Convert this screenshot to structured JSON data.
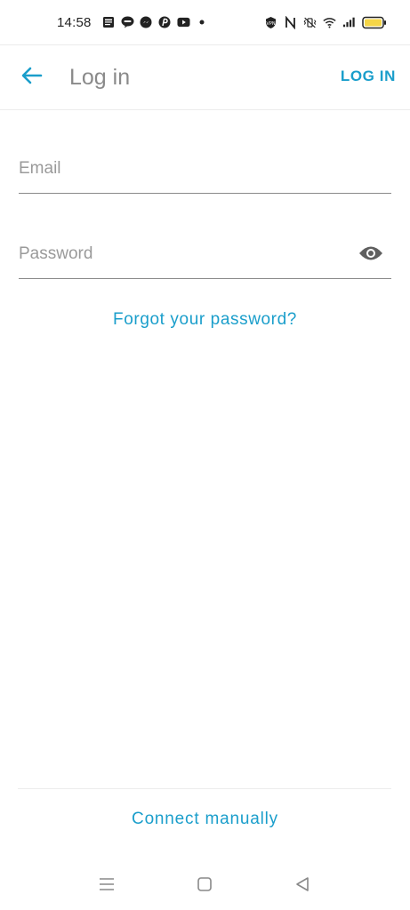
{
  "status_bar": {
    "time": "14:58",
    "left_icons": [
      "news-icon",
      "line-icon",
      "messenger-icon",
      "pinterest-icon",
      "youtube-icon",
      "dot-icon"
    ],
    "right_icons": [
      "vpn-icon",
      "nfc-icon",
      "vibrate-icon",
      "wifi-icon",
      "signal-icon",
      "battery-icon"
    ],
    "battery_color": "#f5d547"
  },
  "app_bar": {
    "back_icon": "arrow-back-icon",
    "title": "Log in",
    "action_label": "LOG IN"
  },
  "form": {
    "email": {
      "placeholder": "Email",
      "value": ""
    },
    "password": {
      "placeholder": "Password",
      "value": "",
      "toggle_icon": "eye-icon"
    },
    "forgot_label": "Forgot your password?"
  },
  "footer": {
    "connect_manually_label": "Connect manually"
  },
  "nav_bar": {
    "icons": [
      "menu-icon",
      "home-icon",
      "back-triangle-icon"
    ]
  },
  "colors": {
    "accent": "#1a9ecb",
    "title": "#8a8a8a",
    "placeholder": "#9a9a9a",
    "underline": "#8a8a8a"
  }
}
